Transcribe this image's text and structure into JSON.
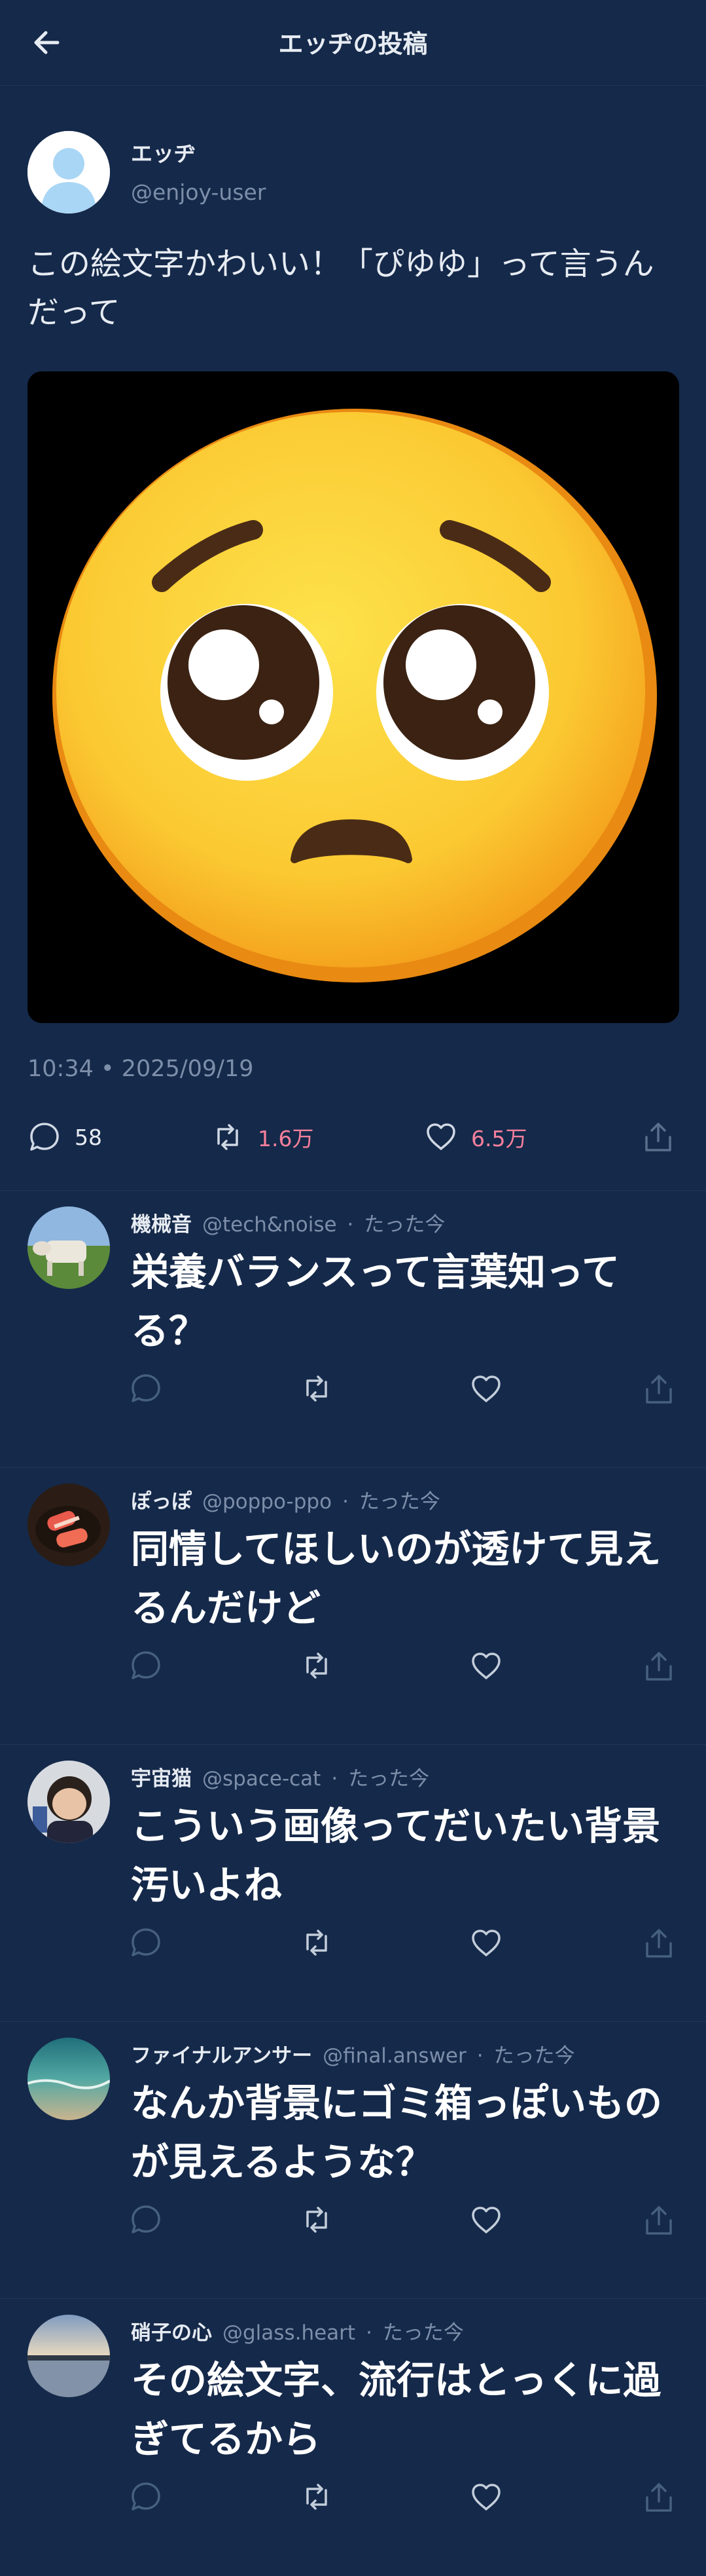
{
  "header": {
    "title": "エッヂの投稿"
  },
  "post": {
    "name": "エッヂ",
    "handle": "@enjoy-user",
    "text": "この絵文字かわいい！「ぴゆゆ」って言うんだって",
    "image_desc_icon": "pleading-face-emoji",
    "timestamp": "10:34 • 2025/09/19",
    "replies": "58",
    "reposts": "1.6万",
    "likes": "6.5万"
  },
  "replies": [
    {
      "name": "機械音",
      "handle": "@tech&noise",
      "time": "たった今",
      "text": "栄養バランスって言葉知ってる？",
      "avatar": "cow-photo"
    },
    {
      "name": "ぽっぽ",
      "handle": "@poppo-ppo",
      "time": "たった今",
      "text": "同情してほしいのが透けて見えるんだけど",
      "avatar": "sushi-photo"
    },
    {
      "name": "宇宙猫",
      "handle": "@space-cat",
      "time": "たった今",
      "text": "こういう画像ってだいたい背景汚いよね",
      "avatar": "baby-photo"
    },
    {
      "name": "ファイナルアンサー",
      "handle": "@final.answer",
      "time": "たった今",
      "text": "なんか背景にゴミ箱っぽいものが見えるような？",
      "avatar": "beach-photo"
    },
    {
      "name": "硝子の心",
      "handle": "@glass.heart",
      "time": "たった今",
      "text": "その絵文字、流行はとっくに過ぎてるから",
      "avatar": "lake-photo"
    }
  ],
  "colors": {
    "background": "#15294a",
    "accent_pink": "#f6809c",
    "muted": "#7d8ea9"
  }
}
